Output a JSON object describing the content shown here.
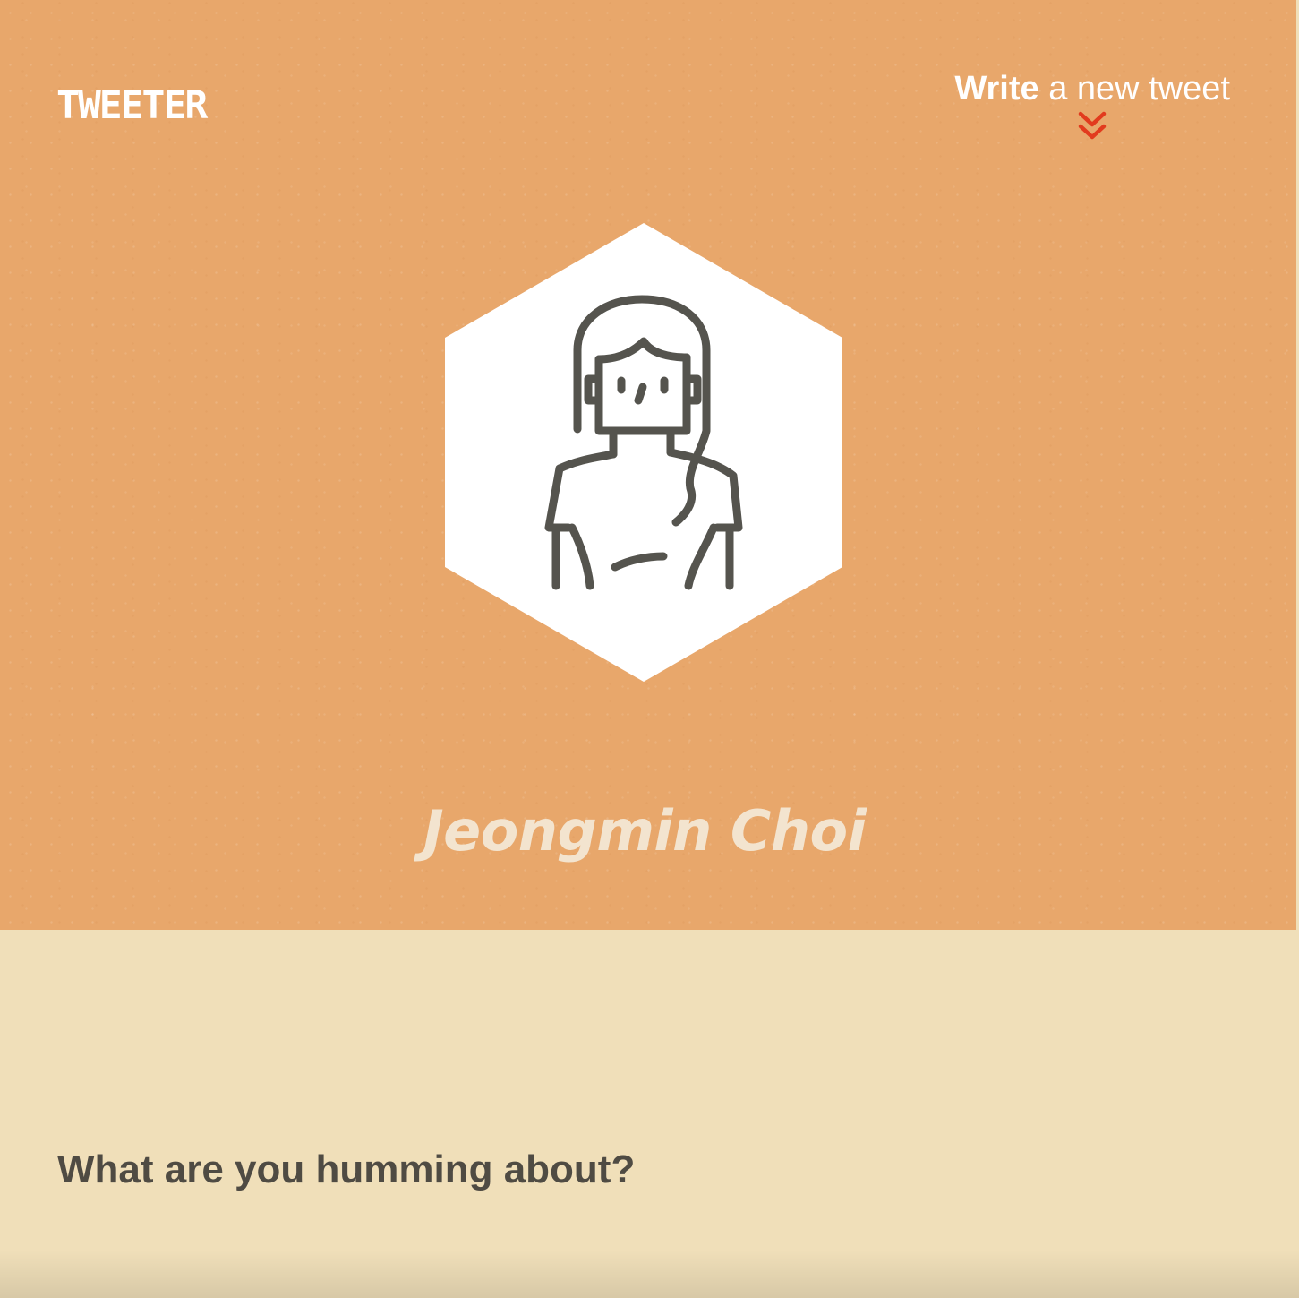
{
  "header": {
    "logo_text": "TWEETER",
    "write_link": {
      "bold_part": "Write",
      "rest": " a new tweet"
    },
    "chevron_icon": "double-chevron-down-icon"
  },
  "profile": {
    "avatar_icon": "woman-avatar-icon",
    "name": "Jeongmin Choi"
  },
  "compose": {
    "prompt": "What are you humming about?"
  },
  "colors": {
    "hero_background": "#e8a76b",
    "compose_background": "#f0dfb9",
    "accent_red": "#e23b1e",
    "avatar_line": "#55544e",
    "prompt_text": "#4f4b43"
  }
}
